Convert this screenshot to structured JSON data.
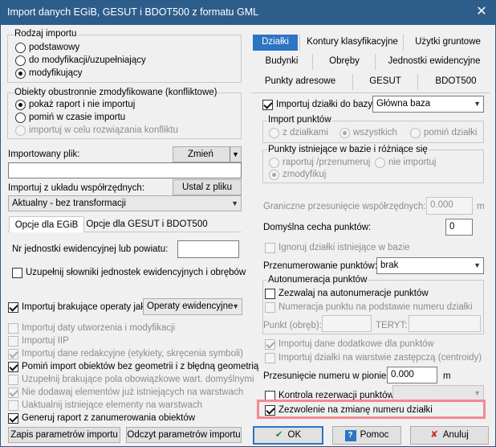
{
  "window": {
    "title": "Import danych EGiB, GESUT i BDOT500 z formatu GML",
    "close_glyph": "✕"
  },
  "rodzaj": {
    "title": "Rodzaj importu",
    "opt1": "podstawowy",
    "opt2": "do modyfikacji/uzupełniający",
    "opt3": "modyfikujący"
  },
  "konflikt": {
    "title": "Obiekty obustronnie zmodyfikowane (konfliktowe)",
    "opt1": "pokaż raport i nie importuj",
    "opt2": "pomiń w czasie importu",
    "opt3": "importuj w celu rozwiązania konfliktu"
  },
  "plik": {
    "label": "Importowany plik:",
    "change": "Zmień",
    "value": ""
  },
  "uklad": {
    "label": "Importuj z układu współrzędnych:",
    "set_btn": "Ustal z pliku",
    "value": "Aktualny - bez transformacji"
  },
  "lefttabs": {
    "tab1": "Opcje dla EGiB",
    "tab2": "Opcje dla GESUT i BDOT500"
  },
  "egib": {
    "nr_label": "Nr jednostki ewidencyjnej lub powiatu:",
    "nr_value": "",
    "uzupelnij": "Uzupełnij słowniki jednostek ewidencyjnych i obrębów",
    "brak_label": "Importuj brakujące operaty jako",
    "brak_value": "Operaty ewidencyjne",
    "c1": "Importuj daty utworzenia i modyfikacji",
    "c2": "Importuj IIP",
    "c3": "Importuj dane redakcyjne (etykiety, skręcenia symboli)",
    "c4": "Pomiń import obiektów bez geometrii i z błędną geometrią",
    "c5": "Uzupełnij brakujące pola obowiązkowe wart. domyślnymi",
    "c6": "Nie dodawaj elementów już istniejących na warstwach",
    "c7": "Uaktualnij istniejące elementy na warstwach",
    "c8": "Generuj raport z zanumerowania obiektów"
  },
  "bottom": {
    "save": "Zapis parametrów importu",
    "read": "Odczyt parametrów importu",
    "ok": "OK",
    "help": "Pomoc",
    "cancel": "Anuluj",
    "help_glyph": "?",
    "ok_glyph": "✔",
    "cancel_glyph": "✘"
  },
  "righttabs": {
    "t1": "Działki",
    "t2": "Kontury klasyfikacyjne",
    "t3": "Użytki gruntowe",
    "t4": "Budynki",
    "t5": "Obręby",
    "t6": "Jednostki ewidencyjne",
    "t7": "Punkty adresowe",
    "t8": "GESUT",
    "t9": "BDOT500"
  },
  "dzialki": {
    "import_label": "Importuj działki do bazy",
    "baza": "Główna baza",
    "punkty_title": "Import punktów",
    "p1": "z działkami",
    "p2": "wszystkich",
    "p3": "pomiń działki",
    "ist_title": "Punkty istniejące w bazie i różniące się",
    "i1": "raportuj /przenumeruj",
    "i2": "nie importuj",
    "i3": "zmodyfikuj",
    "gran_label": "Graniczne przesunięcie współrzędnych:",
    "gran_value": "0.000",
    "unit": "m",
    "cecha_label": "Domyślna cecha punktów:",
    "cecha_value": "0",
    "ignoruj": "Ignoruj działki istniejące w bazie",
    "przen_label": "Przenumerowanie punktów:",
    "przen_value": "brak",
    "auto_title": "Autonumeracja punktów",
    "zezwalaj": "Zezwalaj na autonumeracje punktów",
    "numeracja": "Numeracja punktu na podstawie numeru działki",
    "obreb_label": "Punkt (obręb):",
    "teryt_label": "TERYT:",
    "dodatkowe": "Importuj dane dodatkowe dla punktów",
    "zastepcza": "Importuj działki na warstwie zastępczą (centroidy)",
    "przes_label": "Przesunięcie numeru w pionie:",
    "przes_value": "0.000",
    "kontrola": "Kontrola rezerwacji punktów:",
    "zezwolenie": "Zezwolenie na zmianę numeru działki"
  }
}
